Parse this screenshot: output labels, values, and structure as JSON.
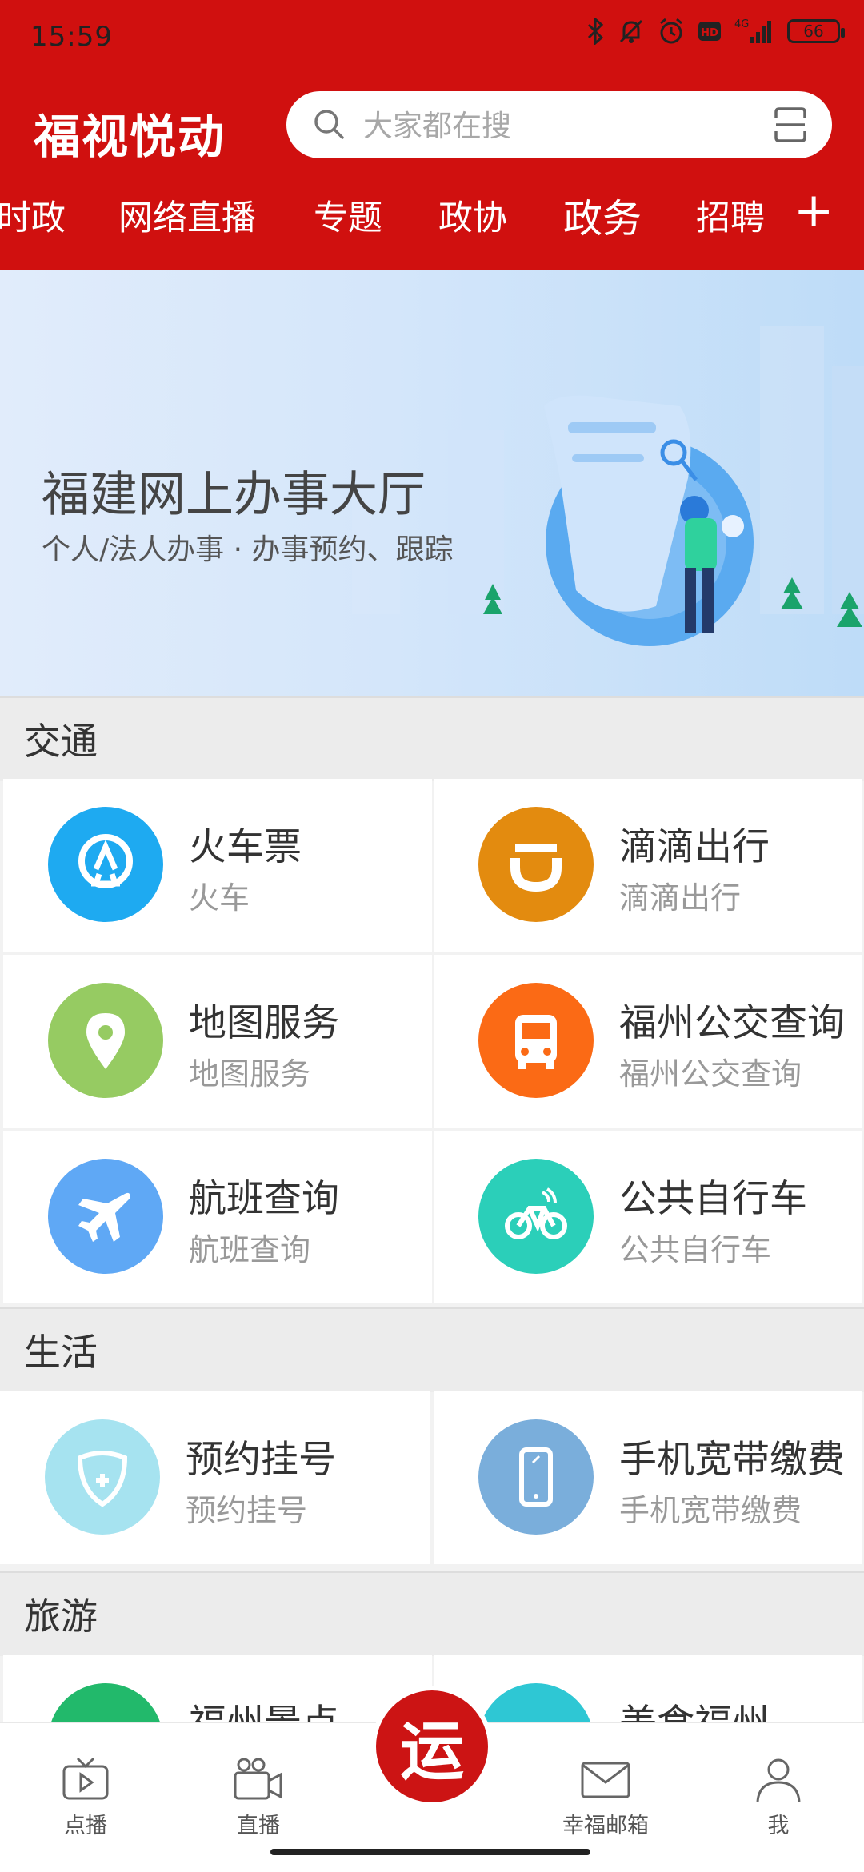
{
  "status": {
    "time": "15:59",
    "battery": "66",
    "network": "4G"
  },
  "header": {
    "logo_text": "福视悦动",
    "search_placeholder": "大家都在搜",
    "tabs": [
      "时政",
      "网络直播",
      "专题",
      "政协",
      "政务",
      "招聘"
    ],
    "active_tab": "政务",
    "add_label": "+"
  },
  "banner": {
    "title": "福建网上办事大厅",
    "subtitle": "个人/法人办事 · 办事预约、跟踪"
  },
  "sections": [
    {
      "title": "交通",
      "items": [
        {
          "title": "火车票",
          "sub": "火车",
          "icon": "train-icon",
          "color": "#1eaaf1"
        },
        {
          "title": "滴滴出行",
          "sub": "滴滴出行",
          "icon": "didi-icon",
          "color": "#e38b0f"
        },
        {
          "title": "地图服务",
          "sub": "地图服务",
          "icon": "map-pin-icon",
          "color": "#96cb62"
        },
        {
          "title": "福州公交查询",
          "sub": "福州公交查询",
          "icon": "bus-icon",
          "color": "#fb6a15"
        },
        {
          "title": "航班查询",
          "sub": "航班查询",
          "icon": "airplane-icon",
          "color": "#5fa8f5"
        },
        {
          "title": "公共自行车",
          "sub": "公共自行车",
          "icon": "bicycle-icon",
          "color": "#2bcfb9"
        }
      ]
    },
    {
      "title": "生活",
      "items": [
        {
          "title": "预约挂号",
          "sub": "预约挂号",
          "icon": "medical-icon",
          "color": "#a6e3f0"
        },
        {
          "title": "手机宽带缴费",
          "sub": "手机宽带缴费",
          "icon": "phone-icon",
          "color": "#7aaedb"
        }
      ]
    },
    {
      "title": "旅游",
      "items": [
        {
          "title": "福州景点",
          "sub": "",
          "icon": "scenic-icon",
          "color": "#22b96b"
        },
        {
          "title": "美食福州",
          "sub": "",
          "icon": "food-icon",
          "color": "#2ec7d4"
        }
      ]
    }
  ],
  "bottom_nav": [
    {
      "label": "点播",
      "icon": "tv-play-icon"
    },
    {
      "label": "直播",
      "icon": "video-camera-icon"
    },
    {
      "label": "幸福邮箱",
      "icon": "mail-icon"
    },
    {
      "label": "我",
      "icon": "user-icon"
    }
  ],
  "center_logo": "运"
}
